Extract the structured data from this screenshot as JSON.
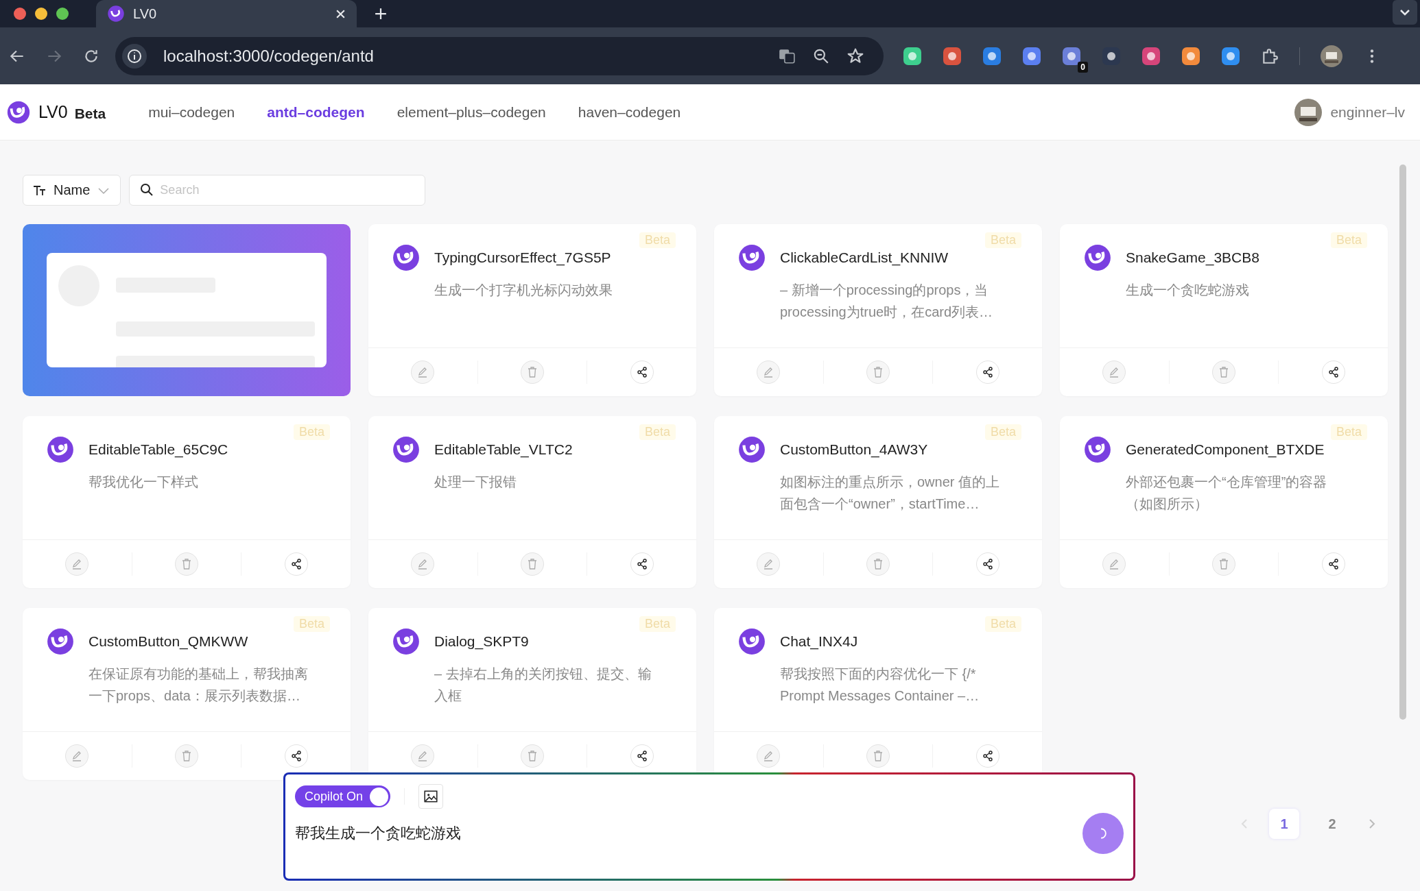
{
  "browser": {
    "tab_title": "LV0",
    "url": "localhost:3000/codegen/antd",
    "extension_badge": "0"
  },
  "header": {
    "logo": "LV0",
    "badge": "Beta",
    "nav": [
      {
        "label": "mui–codegen",
        "selected": false
      },
      {
        "label": "antd–codegen",
        "selected": true
      },
      {
        "label": "element–plus–codegen",
        "selected": false
      },
      {
        "label": "haven–codegen",
        "selected": false
      }
    ],
    "user": "enginner–lv"
  },
  "filter": {
    "sort": "Name",
    "search_placeholder": "Search"
  },
  "cards": [
    {
      "kind": "preview"
    },
    {
      "kind": "component",
      "title": "TypingCursorEffect_7GS5P",
      "badge": "Beta",
      "description": "生成一个打字机光标闪动效果"
    },
    {
      "kind": "component",
      "title": "ClickableCardList_KNNIW",
      "badge": "Beta",
      "description": "– 新增一个processing的props，当processing为true时，在card列表…"
    },
    {
      "kind": "component",
      "title": "SnakeGame_3BCB8",
      "badge": "Beta",
      "description": "生成一个贪吃蛇游戏"
    },
    {
      "kind": "component",
      "title": "EditableTable_65C9C",
      "badge": "Beta",
      "description": "帮我优化一下样式"
    },
    {
      "kind": "component",
      "title": "EditableTable_VLTC2",
      "badge": "Beta",
      "description": "处理一下报错"
    },
    {
      "kind": "component",
      "title": "CustomButton_4AW3Y",
      "badge": "Beta",
      "description": "如图标注的重点所示，owner 值的上面包含一个“owner”，startTime…"
    },
    {
      "kind": "component",
      "title": "GeneratedComponent_BTXDE",
      "badge": "Beta",
      "description": "外部还包裹一个“仓库管理”的容器（如图所示）"
    },
    {
      "kind": "component",
      "title": "CustomButton_QMKWW",
      "badge": "Beta",
      "description": "在保证原有功能的基础上，帮我抽离一下props、data：展示列表数据…"
    },
    {
      "kind": "component",
      "title": "Dialog_SKPT9",
      "badge": "Beta",
      "description": "– 去掉右上角的关闭按钮、提交、输入框"
    },
    {
      "kind": "component",
      "title": "Chat_INX4J",
      "badge": "Beta",
      "description": "帮我按照下面的内容优化一下 {/* Prompt Messages Container –…"
    }
  ],
  "prompt": {
    "copilot_label": "Copilot On",
    "copilot_on": true,
    "value": "帮我生成一个贪吃蛇游戏",
    "loading": true
  },
  "pagination": [
    {
      "label": "1",
      "selected": true
    },
    {
      "label": "2",
      "selected": false
    }
  ]
}
